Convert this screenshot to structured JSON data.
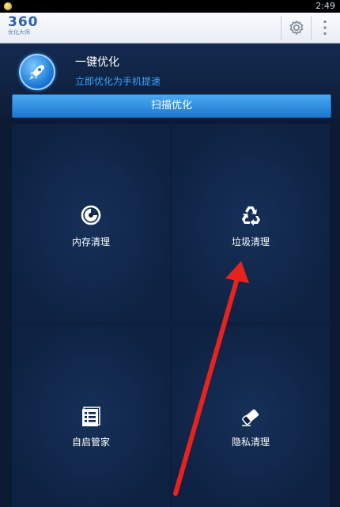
{
  "status_bar": {
    "time": "2:49"
  },
  "app_bar": {
    "logo_number": "360",
    "logo_subtitle": "优化大师",
    "settings_icon": "gear-icon",
    "more_icon": "more-vert-icon"
  },
  "header": {
    "title": "一键优化",
    "subtitle": "立即优化为手机提速",
    "badge_icon": "rocket-icon",
    "scan_button_label": "扫描优化"
  },
  "tiles": [
    {
      "label": "内存清理",
      "icon": "memory-clean-icon"
    },
    {
      "label": "垃圾清理",
      "icon": "recycle-icon"
    },
    {
      "label": "自启管家",
      "icon": "list-icon"
    },
    {
      "label": "隐私清理",
      "icon": "eraser-icon"
    }
  ],
  "colors": {
    "accent": "#1d78cf",
    "subtitle": "#35a6ff",
    "annotation_arrow": "#e8231e"
  }
}
